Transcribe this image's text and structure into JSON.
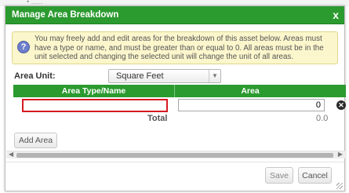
{
  "background": {
    "ghost_text": "• ......"
  },
  "dialog": {
    "title": "Manage Area Breakdown",
    "close_glyph": "x",
    "info_icon": "question-icon",
    "info_message": "You may freely add and edit areas for the breakdown of this asset below. Areas must have a type or name, and must be greater than or equal to 0. All areas must be in the unit selected and changing the selected unit will change the unit of all areas.",
    "area_unit": {
      "label": "Area Unit:",
      "selected": "Square Feet",
      "arrow": "▼"
    },
    "table": {
      "headers": [
        "Area Type/Name",
        "Area"
      ],
      "rows": [
        {
          "name": "",
          "area": "0"
        }
      ],
      "remove_glyph": "✕",
      "total_label": "Total",
      "total_value": "0.0"
    },
    "add_area_label": "Add Area",
    "scroll": {
      "left": "◀",
      "right": "▶"
    },
    "footer": {
      "save_label": "Save",
      "cancel_label": "Cancel"
    }
  },
  "colors": {
    "header_green": "#2b9a2f",
    "info_bg": "#fbf6cc",
    "focus_border": "#d71920"
  }
}
